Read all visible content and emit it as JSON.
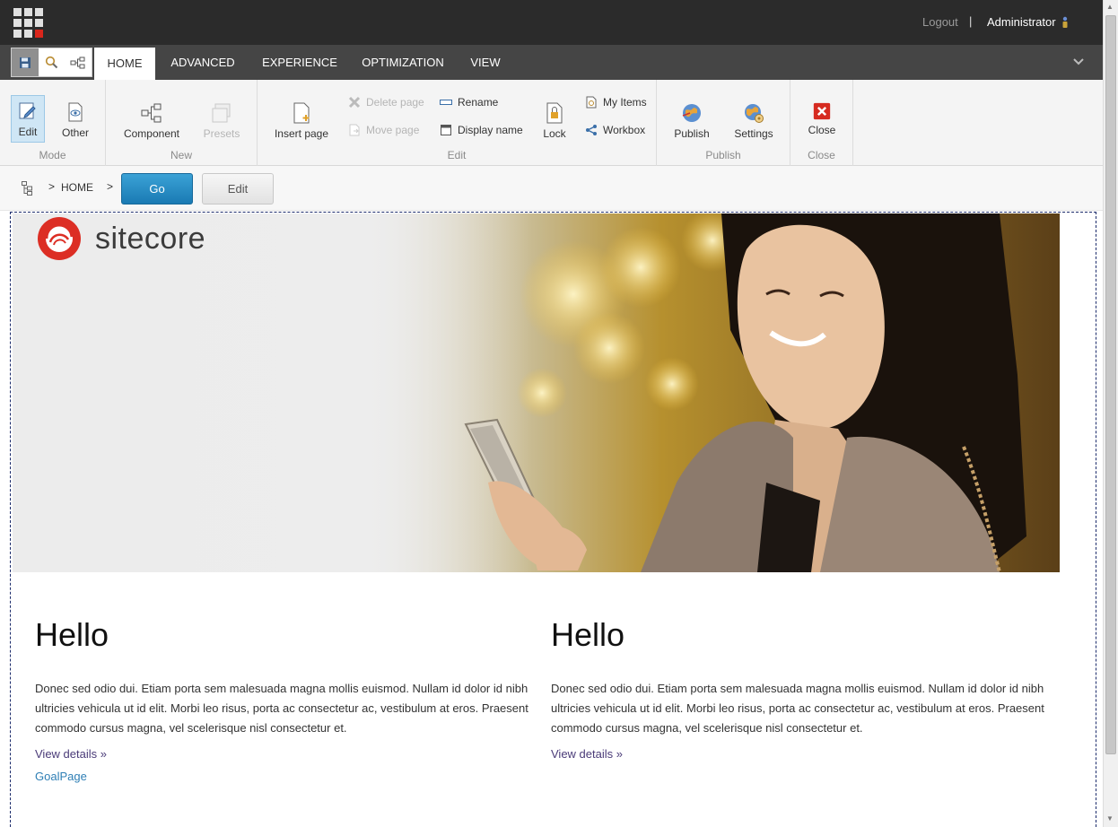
{
  "header": {
    "logout": "Logout",
    "separator": "|",
    "user": "Administrator"
  },
  "tabs": [
    "HOME",
    "ADVANCED",
    "EXPERIENCE",
    "OPTIMIZATION",
    "VIEW"
  ],
  "ribbon": {
    "mode": {
      "label": "Mode",
      "edit": "Edit",
      "other": "Other"
    },
    "new": {
      "label": "New",
      "component": "Component",
      "presets": "Presets"
    },
    "edit": {
      "label": "Edit",
      "insert_page": "Insert page",
      "delete_page": "Delete page",
      "move_page": "Move page",
      "rename": "Rename",
      "display_name": "Display name",
      "lock": "Lock",
      "my_items": "My Items",
      "workbox": "Workbox"
    },
    "publish": {
      "label": "Publish",
      "publish": "Publish",
      "settings": "Settings"
    },
    "close": {
      "label": "Close",
      "close": "Close"
    }
  },
  "navbar": {
    "crumb": "HOME",
    "go": "Go",
    "edit": "Edit"
  },
  "hero": {
    "logo_text": "sitecore"
  },
  "content": {
    "left": {
      "heading": "Hello",
      "body": "Donec sed odio dui. Etiam porta sem malesuada magna mollis euismod. Nullam id dolor id nibh ultricies vehicula ut id elit. Morbi leo risus, porta ac consectetur ac, vestibulum at eros. Praesent commodo cursus magna, vel scelerisque nisl consectetur et.",
      "link": "View details »",
      "goal_link": "GoalPage"
    },
    "right": {
      "heading": "Hello",
      "body": "Donec sed odio dui. Etiam porta sem malesuada magna mollis euismod. Nullam id dolor id nibh ultricies vehicula ut id elit. Morbi leo risus, porta ac consectetur ac, vestibulum at eros. Praesent commodo cursus magna, vel scelerisque nisl consectetur et.",
      "link": "View details »"
    }
  },
  "colors": {
    "accent_blue": "#1a7ab3",
    "topbar": "#2b2b2b",
    "tabbar": "#454545",
    "logo_red": "#d9261c"
  }
}
